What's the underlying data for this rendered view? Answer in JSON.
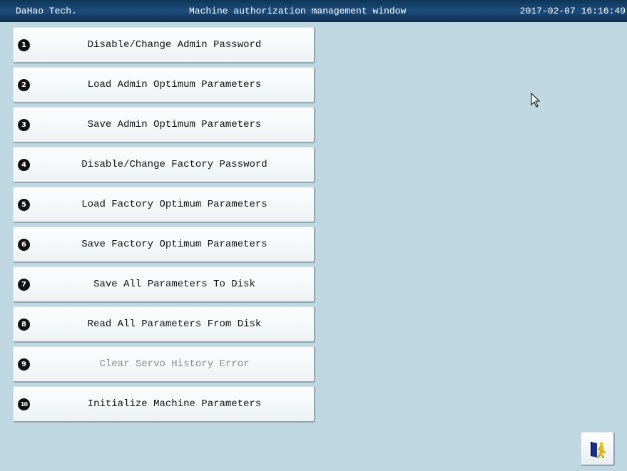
{
  "header": {
    "company": "DaHao Tech.",
    "window_title": "Machine authorization management window",
    "datetime": "2017-02-07 16:16:49"
  },
  "menu": {
    "items": [
      {
        "number": "1",
        "label": "Disable/Change Admin Password",
        "enabled": true
      },
      {
        "number": "2",
        "label": "Load Admin Optimum Parameters",
        "enabled": true
      },
      {
        "number": "3",
        "label": "Save Admin Optimum Parameters",
        "enabled": true
      },
      {
        "number": "4",
        "label": "Disable/Change Factory Password",
        "enabled": true
      },
      {
        "number": "5",
        "label": "Load Factory Optimum Parameters",
        "enabled": true
      },
      {
        "number": "6",
        "label": "Save Factory Optimum Parameters",
        "enabled": true
      },
      {
        "number": "7",
        "label": "Save All Parameters To Disk",
        "enabled": true
      },
      {
        "number": "8",
        "label": "Read All Parameters From Disk",
        "enabled": true
      },
      {
        "number": "9",
        "label": "Clear Servo History Error",
        "enabled": false
      },
      {
        "number": "10",
        "label": "Initialize Machine Parameters",
        "enabled": true
      }
    ]
  },
  "exit_button": {
    "icon": "exit-door-icon"
  },
  "colors": {
    "background": "#bfd7e0",
    "titlebar": "#1d4e7c",
    "disabled_text": "#8a8a8a"
  }
}
